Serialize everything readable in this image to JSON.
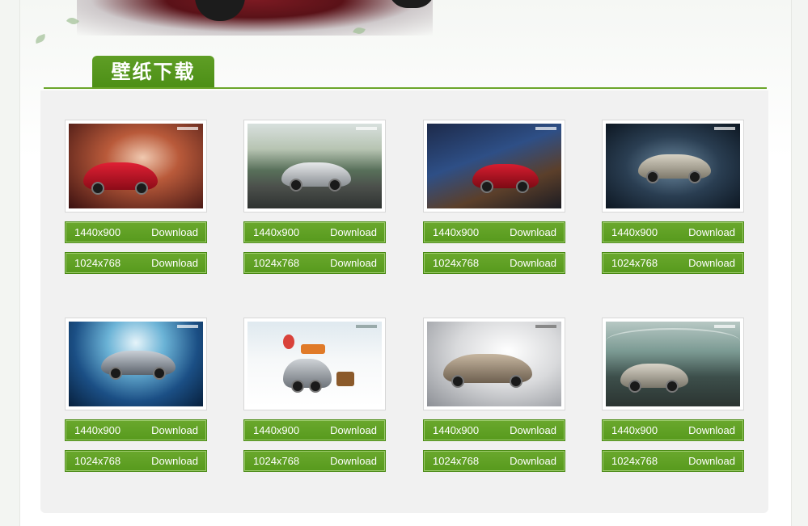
{
  "section": {
    "title": "壁纸下载"
  },
  "download_label": "Download",
  "colors": {
    "accent": "#5a9b1f",
    "panel": "#f1f1f1"
  },
  "wallpapers": [
    {
      "theme": "red-car-light-streaks",
      "options": [
        {
          "resolution": "1440x900"
        },
        {
          "resolution": "1024x768"
        }
      ]
    },
    {
      "theme": "silver-car-forest",
      "options": [
        {
          "resolution": "1440x900"
        },
        {
          "resolution": "1024x768"
        }
      ]
    },
    {
      "theme": "red-car-night-city",
      "options": [
        {
          "resolution": "1440x900"
        },
        {
          "resolution": "1024x768"
        }
      ]
    },
    {
      "theme": "silver-car-dark-road",
      "options": [
        {
          "resolution": "1440x900"
        },
        {
          "resolution": "1024x768"
        }
      ]
    },
    {
      "theme": "silver-car-blue-water",
      "options": [
        {
          "resolution": "1440x900"
        },
        {
          "resolution": "1024x768"
        }
      ]
    },
    {
      "theme": "car-balloons-travel",
      "options": [
        {
          "resolution": "1440x900"
        },
        {
          "resolution": "1024x768"
        }
      ]
    },
    {
      "theme": "bronze-car-studio",
      "options": [
        {
          "resolution": "1440x900"
        },
        {
          "resolution": "1024x768"
        }
      ]
    },
    {
      "theme": "silver-car-stadium",
      "options": [
        {
          "resolution": "1440x900"
        },
        {
          "resolution": "1024x768"
        }
      ]
    }
  ]
}
